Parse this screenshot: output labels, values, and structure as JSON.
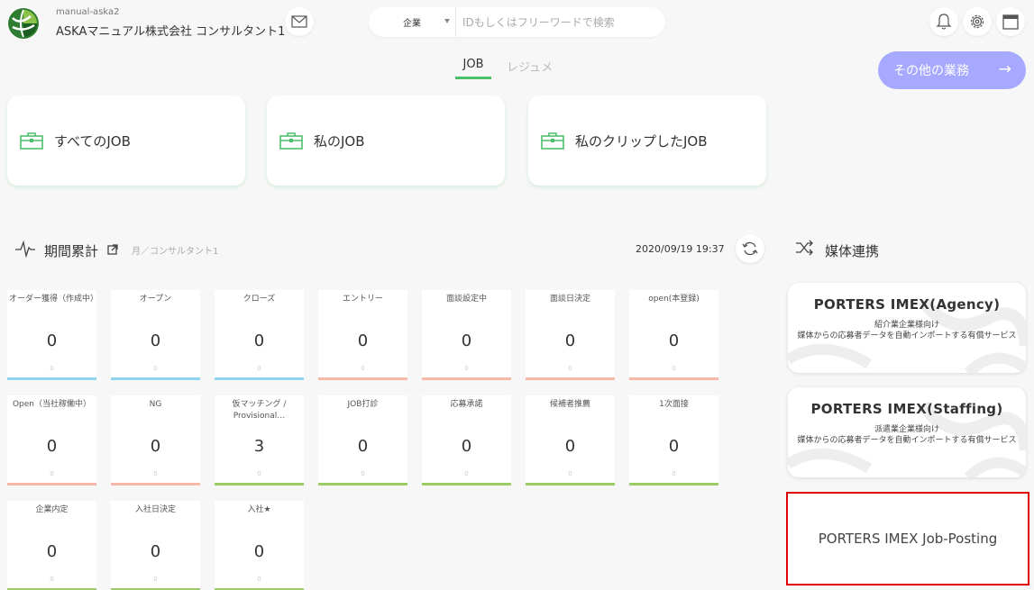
{
  "header": {
    "account_sub": "manual-aska2",
    "account_name": "ASKAマニュアル株式会社 コンサルタント1",
    "search_select": "企業",
    "search_placeholder": "IDもしくはフリーワードで検索"
  },
  "icons": {
    "logo": "logo-icon",
    "mail": "mail-icon",
    "bell": "bell-icon",
    "settings": "gear-icon",
    "calendar": "calendar-icon",
    "briefcase": "briefcase-icon",
    "pulse": "pulse-icon",
    "external": "external-link-icon",
    "refresh": "refresh-icon",
    "shuffle": "shuffle-icon"
  },
  "colors": {
    "accent_green": "#4cbf6a",
    "other_button": "#a6a9ff",
    "bar_blue": "#8fd4f0",
    "bar_salmon": "#f7b9a8",
    "bar_green": "#9ccc65",
    "highlight_red": "#e00000"
  },
  "tabs": [
    {
      "label": "JOB",
      "active": true
    },
    {
      "label": "レジュメ",
      "active": false
    }
  ],
  "other_button": {
    "label": "その他の業務",
    "arrow": "→"
  },
  "job_cards": [
    {
      "label": "すべてのJOB"
    },
    {
      "label": "私のJOB"
    },
    {
      "label": "私のクリップしたJOB"
    }
  ],
  "stats": {
    "title": "期間累計",
    "subtitle": "月／コンサルタント1",
    "timestamp": "2020/09/19 19:37",
    "tiles": [
      {
        "label": "オーダー獲得（作成中）",
        "value": "0",
        "sub": "0",
        "bar": "blue"
      },
      {
        "label": "オープン",
        "value": "0",
        "sub": "0",
        "bar": "blue"
      },
      {
        "label": "クローズ",
        "value": "0",
        "sub": "0",
        "bar": "blue"
      },
      {
        "label": "エントリー",
        "value": "0",
        "sub": "0",
        "bar": "salmon"
      },
      {
        "label": "面談設定中",
        "value": "0",
        "sub": "0",
        "bar": "salmon"
      },
      {
        "label": "面談日決定",
        "value": "0",
        "sub": "0",
        "bar": "salmon"
      },
      {
        "label": "open(本登録)",
        "value": "0",
        "sub": "0",
        "bar": "salmon"
      },
      {
        "label": "Open（当社稼働中）",
        "value": "0",
        "sub": "0",
        "bar": "salmon"
      },
      {
        "label": "NG",
        "value": "0",
        "sub": "0",
        "bar": "salmon"
      },
      {
        "label": "仮マッチング / Provisional…",
        "value": "3",
        "sub": "0",
        "bar": "green"
      },
      {
        "label": "JOB打診",
        "value": "0",
        "sub": "0",
        "bar": "green"
      },
      {
        "label": "応募承諾",
        "value": "0",
        "sub": "0",
        "bar": "green"
      },
      {
        "label": "候補者推薦",
        "value": "0",
        "sub": "0",
        "bar": "green"
      },
      {
        "label": "1次面接",
        "value": "0",
        "sub": "0",
        "bar": "green"
      },
      {
        "label": "企業内定",
        "value": "0",
        "sub": "0",
        "bar": "green"
      },
      {
        "label": "入社日決定",
        "value": "0",
        "sub": "0",
        "bar": "green"
      },
      {
        "label": "入社★",
        "value": "0",
        "sub": "0",
        "bar": "green"
      }
    ]
  },
  "media": {
    "title": "媒体連携",
    "cards": [
      {
        "title": "PORTERS IMEX(Agency)",
        "line1": "紹介業企業様向け",
        "line2": "媒体からの応募者データを自動インポートする有償サービス"
      },
      {
        "title": "PORTERS IMEX(Staffing)",
        "line1": "派遣業企業様向け",
        "line2": "媒体からの応募者データを自動インポートする有償サービス"
      }
    ],
    "job_posting": "PORTERS IMEX Job-Posting"
  }
}
